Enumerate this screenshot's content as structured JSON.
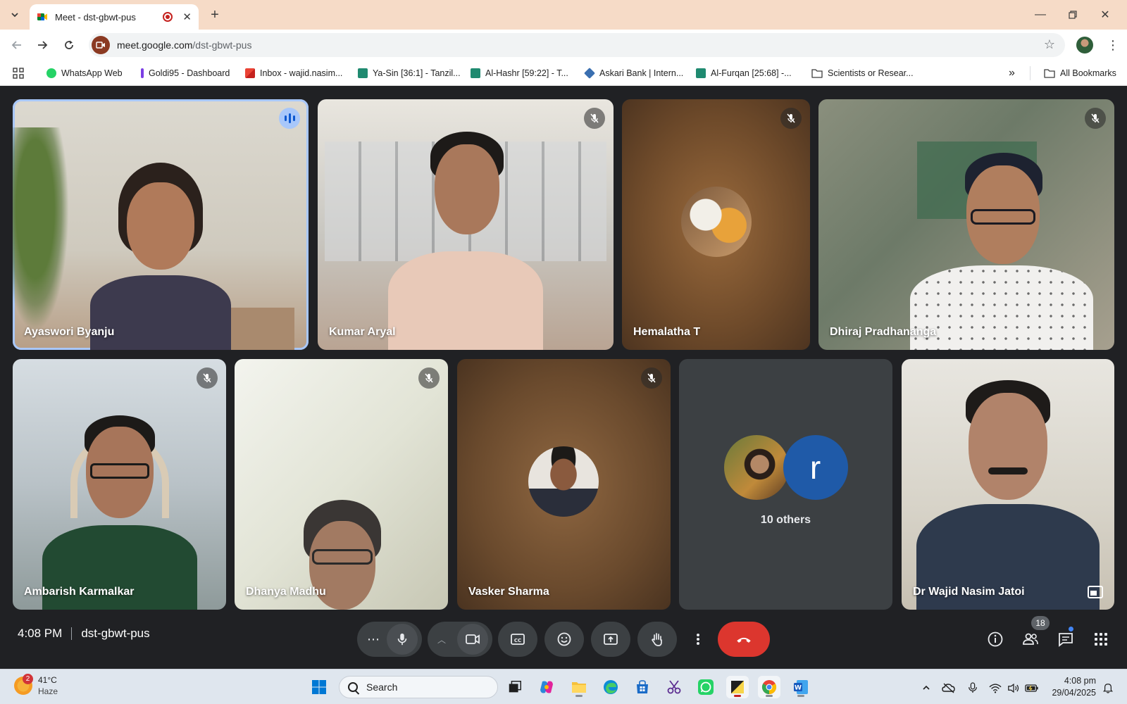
{
  "browser": {
    "tab_title": "Meet - dst-gbwt-pus",
    "url_domain": "meet.google.com",
    "url_path": "/dst-gbwt-pus",
    "bookmarks": [
      {
        "label": "WhatsApp Web",
        "icon": "whatsapp-icon",
        "color": "#25d366"
      },
      {
        "label": "Goldi95 - Dashboard",
        "icon": "goldi-icon",
        "color": "#7b3fe4"
      },
      {
        "label": "Inbox - wajid.nasim...",
        "icon": "gmail-icon",
        "color": "#ea4335"
      },
      {
        "label": "Ya-Sin [36:1] - Tanzil...",
        "icon": "tanzil-icon",
        "color": "#1f8a70"
      },
      {
        "label": "Al-Hashr [59:22] - T...",
        "icon": "tanzil-icon",
        "color": "#1f8a70"
      },
      {
        "label": "Askari Bank | Intern...",
        "icon": "askari-icon",
        "color": "#3a6fb0"
      },
      {
        "label": "Al-Furqan [25:68] -...",
        "icon": "tanzil-icon",
        "color": "#1f8a70"
      },
      {
        "label": "Scientists or Resear...",
        "icon": "folder-icon",
        "color": "#5f6368"
      }
    ],
    "overflow": "»",
    "all_bookmarks": "All Bookmarks"
  },
  "meet": {
    "participants": [
      {
        "name": "Ayaswori Byanju",
        "state": "speaking"
      },
      {
        "name": "Kumar Aryal",
        "state": "muted"
      },
      {
        "name": "Hemalatha T",
        "state": "muted"
      },
      {
        "name": "Dhiraj Pradhananga",
        "state": "muted"
      },
      {
        "name": "Ambarish Karmalkar",
        "state": "muted"
      },
      {
        "name": "Dhanya Madhu",
        "state": "muted"
      },
      {
        "name": "Vasker Sharma",
        "state": "muted"
      },
      {
        "name": "Dr Wajid Nasim Jatoi",
        "state": "self"
      }
    ],
    "others_label": "10 others",
    "others_avatar_letter": "r",
    "time": "4:08 PM",
    "meeting_code": "dst-gbwt-pus",
    "people_count": "18",
    "accent": "#a8c7fa",
    "end_call_color": "#dc362e"
  },
  "taskbar": {
    "weather_alerts": "2",
    "temperature": "41°C",
    "condition": "Haze",
    "search_placeholder": "Search",
    "time": "4:08 pm",
    "date": "29/04/2025"
  }
}
